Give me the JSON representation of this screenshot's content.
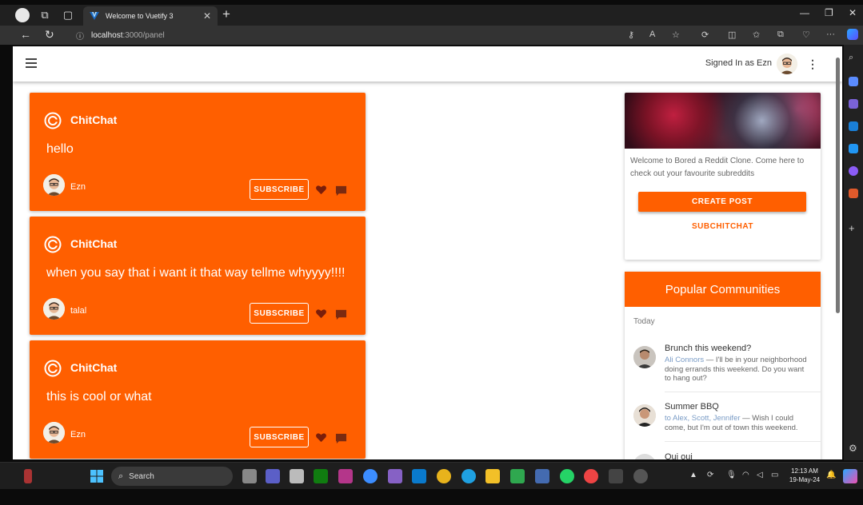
{
  "browser": {
    "tab_title": "Welcome to Vuetify 3",
    "url_host": "localhost",
    "url_path": ":3000/panel"
  },
  "app_bar": {
    "signed_in_text": "Signed In as Ezn"
  },
  "posts": [
    {
      "subreddit": "ChitChat",
      "body": "hello",
      "author": "Ezn",
      "subscribe_label": "SUBSCRIBE"
    },
    {
      "subreddit": "ChitChat",
      "body": "when you say that i want it that way tellme whyyyy!!!!",
      "author": "talal",
      "subscribe_label": "SUBSCRIBE"
    },
    {
      "subreddit": "ChitChat",
      "body": "this is cool or what",
      "author": "Ezn",
      "subscribe_label": "SUBSCRIBE"
    }
  ],
  "info_card": {
    "text": "Welcome to Bored a Reddit Clone. Come here to check out your favourite subreddits",
    "create_post_label": "CREATE POST",
    "subchitchat_label": "SUBCHITCHAT"
  },
  "popular": {
    "title": "Popular Communities",
    "section_label": "Today",
    "items": [
      {
        "title": "Brunch this weekend?",
        "highlight": "Ali Connors",
        "text": " — I'll be in your neighborhood doing errands this weekend. Do you want to hang out?"
      },
      {
        "title": "Summer BBQ",
        "highlight": "to Alex, Scott, Jennifer",
        "text": " — Wish I could come, but I'm out of town this weekend."
      },
      {
        "title": "Oui oui",
        "highlight": "",
        "text": ""
      }
    ]
  },
  "taskbar": {
    "search_label": "Search",
    "time": "12:13 AM",
    "date": "19-May-24"
  },
  "colors": {
    "accent": "#ff5f00",
    "browser_dark": "#202020"
  }
}
